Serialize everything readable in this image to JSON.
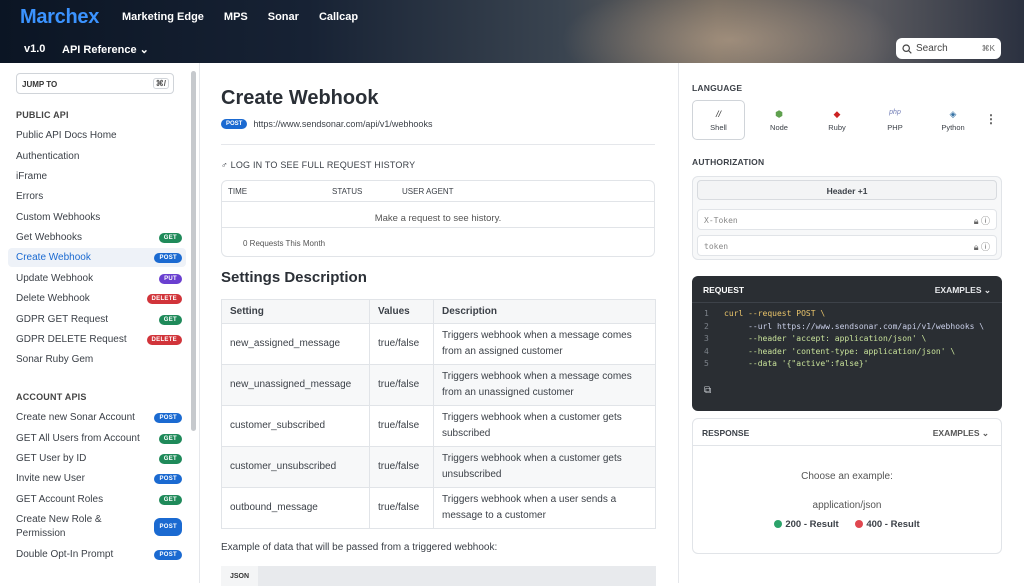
{
  "header": {
    "logo": "Marchex",
    "nav": [
      "Marketing Edge",
      "MPS",
      "Sonar",
      "Callcap"
    ],
    "version": "v1.0",
    "api_reference": "API Reference ⌄",
    "search_placeholder": "Search",
    "search_shortcut": "⌘K"
  },
  "sidebar": {
    "jump_to": "JUMP TO",
    "jump_shortcut": "⌘/",
    "sections": [
      {
        "title": "PUBLIC API",
        "items": [
          {
            "label": "Public API Docs Home"
          },
          {
            "label": "Authentication"
          },
          {
            "label": "iFrame"
          },
          {
            "label": "Errors"
          },
          {
            "label": "Custom Webhooks"
          },
          {
            "label": "Get Webhooks",
            "badge": "GET"
          },
          {
            "label": "Create Webhook",
            "badge": "POST",
            "active": true
          },
          {
            "label": "Update Webhook",
            "badge": "PUT"
          },
          {
            "label": "Delete Webhook",
            "badge": "DELETE"
          },
          {
            "label": "GDPR GET Request",
            "badge": "GET"
          },
          {
            "label": "GDPR DELETE Request",
            "badge": "DELETE"
          },
          {
            "label": "Sonar Ruby Gem"
          }
        ]
      },
      {
        "title": "ACCOUNT APIS",
        "items": [
          {
            "label": "Create new Sonar Account",
            "badge": "POST"
          },
          {
            "label": "GET All Users from Account",
            "badge": "GET"
          },
          {
            "label": "GET User by ID",
            "badge": "GET"
          },
          {
            "label": "Invite new User",
            "badge": "POST"
          },
          {
            "label": "GET Account Roles",
            "badge": "GET"
          },
          {
            "label": "Create New Role & Permission",
            "badge": "POST"
          },
          {
            "label": "Double Opt-In Prompt",
            "badge": "POST"
          }
        ]
      }
    ]
  },
  "main": {
    "title": "Create Webhook",
    "method": "POST",
    "url": "https://www.sendsonar.com/api/v1/webhooks",
    "login_history": "♂ LOG IN TO SEE FULL REQUEST HISTORY",
    "history_columns": [
      "TIME",
      "STATUS",
      "USER AGENT"
    ],
    "history_empty": "Make a request to see history.",
    "history_count": "0 Requests This Month",
    "settings_title": "Settings Description",
    "table_headers": [
      "Setting",
      "Values",
      "Description"
    ],
    "table_rows": [
      [
        "new_assigned_message",
        "true/false",
        "Triggers webhook when a message comes from an assigned customer"
      ],
      [
        "new_unassigned_message",
        "true/false",
        "Triggers webhook when a message comes from an unassigned customer"
      ],
      [
        "customer_subscribed",
        "true/false",
        "Triggers webhook when a customer gets subscribed"
      ],
      [
        "customer_unsubscribed",
        "true/false",
        "Triggers webhook when a customer gets unsubscribed"
      ],
      [
        "outbound_message",
        "true/false",
        "Triggers webhook when a user sends a message to a customer"
      ]
    ],
    "example_text": "Example of data that will be passed from a triggered webhook:",
    "json_label": "JSON"
  },
  "right": {
    "language_label": "LANGUAGE",
    "languages": [
      {
        "name": "Shell",
        "icon": "//"
      },
      {
        "name": "Node",
        "icon": "⬢"
      },
      {
        "name": "Ruby",
        "icon": "◆"
      },
      {
        "name": "PHP",
        "icon": "php"
      },
      {
        "name": "Python",
        "icon": "◈"
      }
    ],
    "more": "⋮",
    "authorization_label": "AUTHORIZATION",
    "auth_header": "Header +1",
    "auth_fields": [
      "X-Token",
      "token"
    ],
    "request_label": "REQUEST",
    "examples_label": "EXAMPLES ⌄",
    "code_lines": [
      {
        "n": "1",
        "text": "curl --request POST \\"
      },
      {
        "n": "2",
        "text": "     --url https://www.sendsonar.com/api/v1/webhooks \\"
      },
      {
        "n": "3",
        "text": "     --header 'accept: application/json' \\"
      },
      {
        "n": "4",
        "text": "     --header 'content-type: application/json' \\"
      },
      {
        "n": "5",
        "text": "     --data '{\"active\":false}'"
      }
    ],
    "response_label": "RESPONSE",
    "response_examples": "EXAMPLES ⌄",
    "choose_example": "Choose an example:",
    "content_type": "application/json",
    "result_200": "200 - Result",
    "result_400": "400 - Result",
    "colors": {
      "ok": "#2ba36a",
      "err": "#e0474f"
    }
  }
}
